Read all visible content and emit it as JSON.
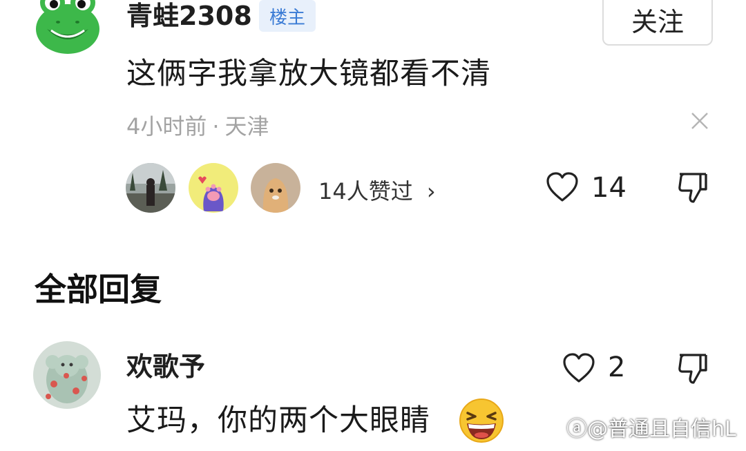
{
  "post": {
    "username": "青蛙2308",
    "badge": "楼主",
    "follow_label": "关注",
    "comment": "这俩字我拿放大镜都看不清",
    "time": "4小时前",
    "separator": "·",
    "location": "天津",
    "likers_summary": "14人赞过",
    "likers_chevron": "›",
    "like_count": "14",
    "icons": [
      "frog-avatar-icon",
      "close-icon",
      "heart-icon",
      "dislike-icon",
      "chevron-right-icon"
    ]
  },
  "replies": {
    "title": "全部回复",
    "items": [
      {
        "username": "欢歌予",
        "comment": "艾玛，你的两个大眼睛",
        "like_count": "2",
        "emoji": "laughing-emoji"
      }
    ]
  },
  "watermark": "ⓐ@普通且自信hL",
  "colors": {
    "badge_bg": "#e8f0fb",
    "badge_text": "#3a7bd5",
    "meta_gray": "#a3a3a3",
    "frog_green": "#3db84a"
  }
}
